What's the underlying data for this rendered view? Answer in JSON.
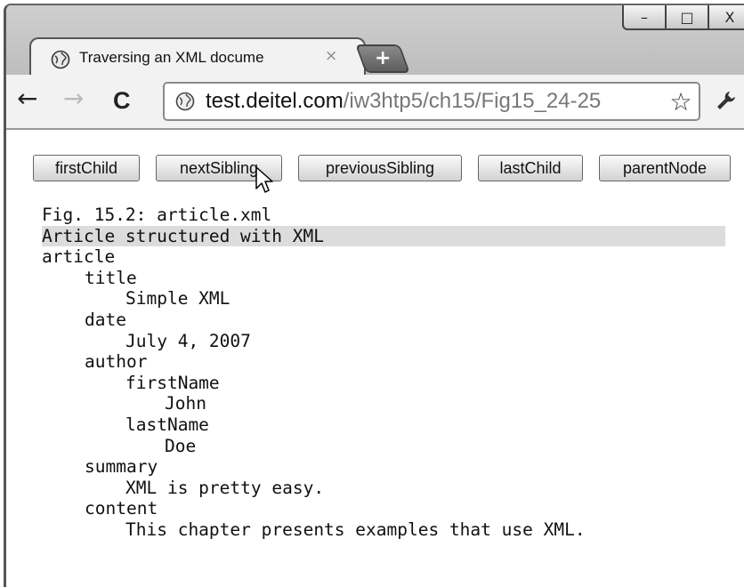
{
  "window": {
    "controls": {
      "minimize": "–",
      "maximize": "□",
      "close": "X"
    }
  },
  "tab": {
    "title": "Traversing an XML docume",
    "close_glyph": "×",
    "new_tab_glyph": "+"
  },
  "toolbar": {
    "back_glyph": "←",
    "forward_glyph": "→",
    "reload_glyph": "C",
    "url_host": "test.deitel.com",
    "url_path": "/iw3htp5/ch15/Fig15_24-25",
    "star_glyph": "☆",
    "wrench_glyph": "🔧"
  },
  "buttons": {
    "firstChild": "firstChild",
    "nextSibling": "nextSibling",
    "previousSibling": "previousSibling",
    "lastChild": "lastChild",
    "parentNode": "parentNode"
  },
  "tree": {
    "comment": "Fig. 15.2: article.xml",
    "highlighted": "Article structured with XML",
    "article": "article",
    "title": "title",
    "title_text": "Simple XML",
    "date": "date",
    "date_text": "July 4, 2007",
    "author": "author",
    "firstName": "firstName",
    "firstName_text": "John",
    "lastName": "lastName",
    "lastName_text": "Doe",
    "summary": "summary",
    "summary_text": "XML is pretty easy.",
    "content": "content",
    "content_text": "This chapter presents examples that use XML."
  },
  "icons": {
    "tab_favicon": "globe-icon",
    "omnibox_icon": "globe-icon",
    "cursor": "mouse-pointer-icon",
    "wrench": "wrench-icon",
    "star": "bookmark-star-icon"
  },
  "colors": {
    "highlight": "#dcdcdc",
    "chrome_frame": "#c8c8c8",
    "page_bg": "#ffffff"
  }
}
